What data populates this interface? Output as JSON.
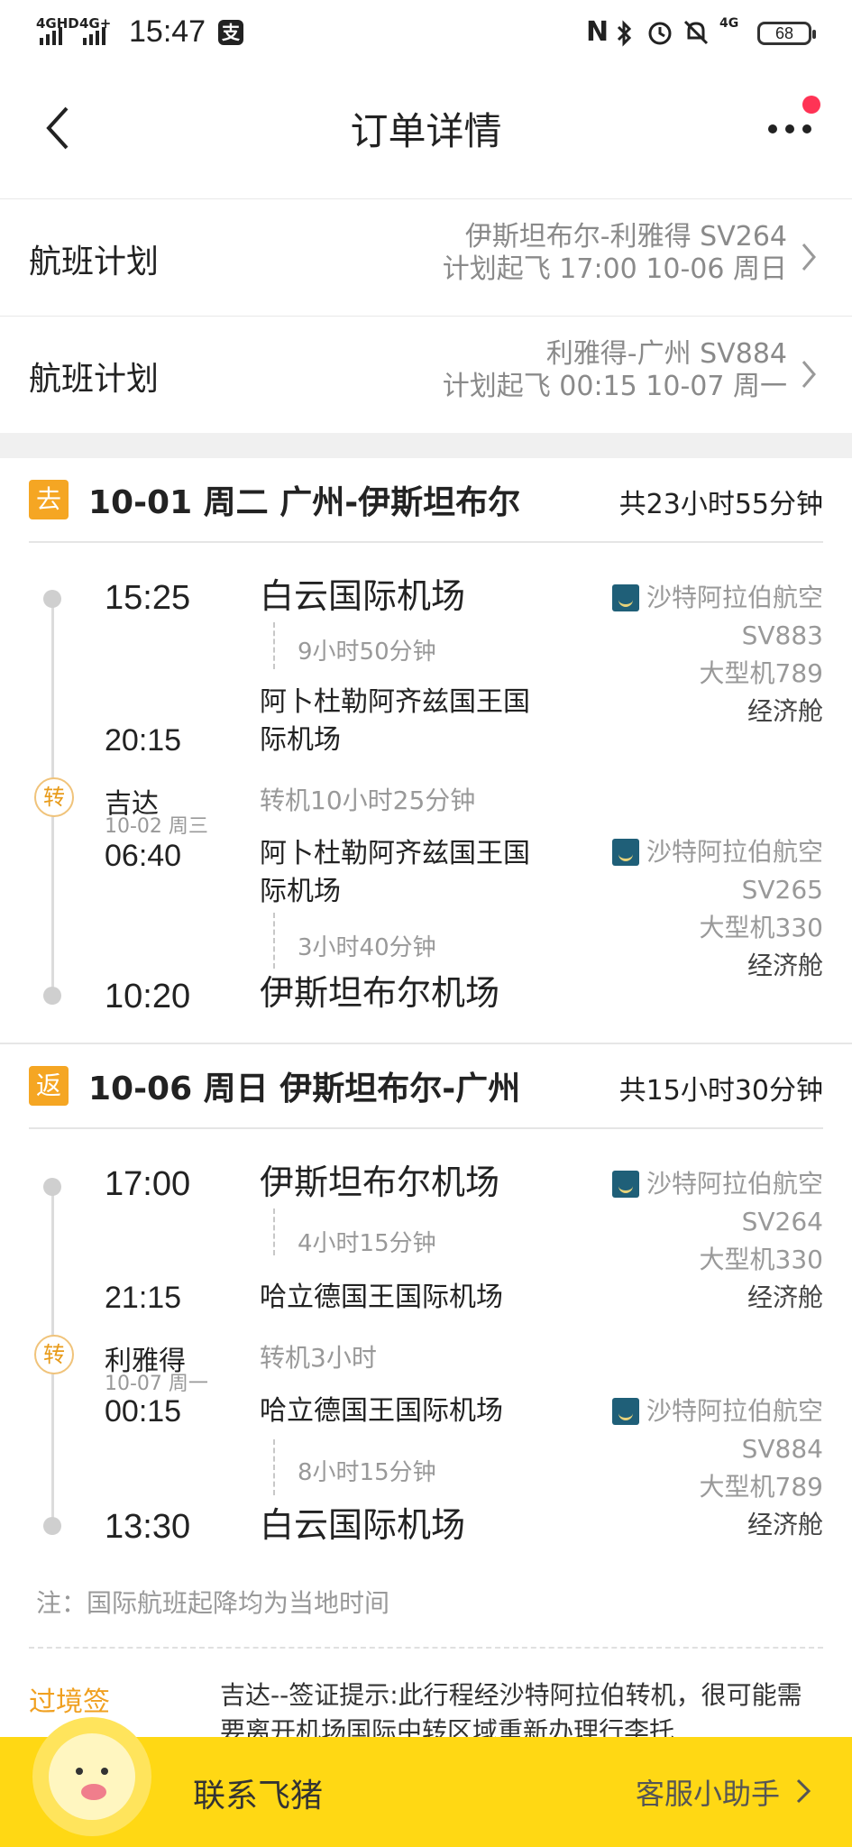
{
  "status_bar": {
    "sig1_label": "4GHD",
    "sig2_label": "4G+",
    "time": "15:47",
    "pay_icon": "支",
    "nfc": "N",
    "net_label": "4G",
    "battery": "68"
  },
  "nav": {
    "title": "订单详情"
  },
  "flight_plans": [
    {
      "label": "航班计划",
      "route": "伊斯坦布尔-利雅得 SV264",
      "departure": "计划起飞 17:00 10-06 周日"
    },
    {
      "label": "航班计划",
      "route": "利雅得-广州 SV884",
      "departure": "计划起飞 00:15 10-07 周一"
    }
  ],
  "outbound": {
    "tag": "去",
    "title": "10-01 周二 广州-伊斯坦布尔",
    "total": "共23小时55分钟",
    "leg1": {
      "dep_time": "15:25",
      "dep_airport": "白云国际机场",
      "duration": "9小时50分钟",
      "arr_time": "20:15",
      "arr_airport_l1": "阿卜杜勒阿齐兹国王国",
      "arr_airport_l2": "际机场",
      "airline": "沙特阿拉伯航空",
      "flight_no": "SV883",
      "aircraft": "大型机789",
      "cabin": "经济舱"
    },
    "transfer": {
      "tag": "转",
      "city": "吉达",
      "date": "10-02 周三",
      "text": "转机10小时25分钟"
    },
    "leg2": {
      "dep_time": "06:40",
      "dep_airport_l1": "阿卜杜勒阿齐兹国王国",
      "dep_airport_l2": "际机场",
      "duration": "3小时40分钟",
      "arr_time": "10:20",
      "arr_airport": "伊斯坦布尔机场",
      "airline": "沙特阿拉伯航空",
      "flight_no": "SV265",
      "aircraft": "大型机330",
      "cabin": "经济舱"
    }
  },
  "return": {
    "tag": "返",
    "title": "10-06 周日 伊斯坦布尔-广州",
    "total": "共15小时30分钟",
    "leg1": {
      "dep_time": "17:00",
      "dep_airport": "伊斯坦布尔机场",
      "duration": "4小时15分钟",
      "arr_time": "21:15",
      "arr_airport": "哈立德国王国际机场",
      "airline": "沙特阿拉伯航空",
      "flight_no": "SV264",
      "aircraft": "大型机330",
      "cabin": "经济舱"
    },
    "transfer": {
      "tag": "转",
      "city": "利雅得",
      "date": "10-07 周一",
      "text": "转机3小时"
    },
    "leg2": {
      "dep_time": "00:15",
      "dep_airport": "哈立德国王国际机场",
      "duration": "8小时15分钟",
      "arr_time": "13:30",
      "arr_airport": "白云国际机场",
      "airline": "沙特阿拉伯航空",
      "flight_no": "SV884",
      "aircraft": "大型机789",
      "cabin": "经济舱"
    }
  },
  "note": "注：国际航班起降均为当地时间",
  "visa": {
    "label": "过境签",
    "text": "吉达--签证提示:此行程经沙特阿拉伯转机，很可能需要离开机场国际中转区域重新办理行李托"
  },
  "bottom": {
    "contact": "联系飞猪",
    "helper": "客服小助手"
  }
}
